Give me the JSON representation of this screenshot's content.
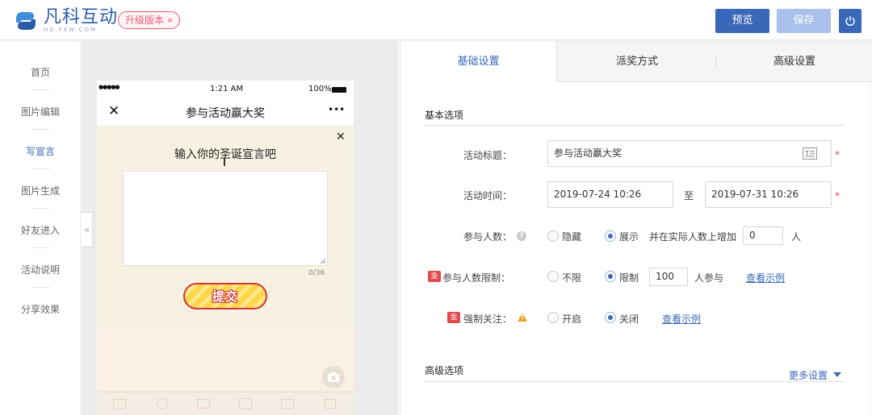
{
  "header": {
    "logo_name": "凡科互动",
    "logo_domain": "HD.FKW.COM",
    "upgrade_label": "升级版本 »",
    "preview_label": "预览",
    "save_label": "保存"
  },
  "nav": {
    "items": [
      {
        "label": "首页",
        "active": false
      },
      {
        "label": "图片编辑",
        "active": false
      },
      {
        "label": "写宣言",
        "active": true
      },
      {
        "label": "图片生成",
        "active": false
      },
      {
        "label": "好友进入",
        "active": false
      },
      {
        "label": "活动说明",
        "active": false
      },
      {
        "label": "分享效果",
        "active": false
      }
    ],
    "collapse_label": "«"
  },
  "phone": {
    "status_dots": "●●●●●",
    "status_time": "1:21 AM",
    "status_battery": "100%",
    "title": "参与活动赢大奖",
    "close_label": "✕",
    "more_label": "•••",
    "dialog_close": "✕",
    "prompt": "输入你的圣诞宣言吧",
    "counter": "0/36",
    "submit_label": "提交"
  },
  "tabs": [
    {
      "label": "基础设置",
      "active": true
    },
    {
      "label": "派奖方式",
      "active": false
    },
    {
      "label": "高级设置",
      "active": false
    }
  ],
  "basic": {
    "section_title": "基本选项",
    "title_label": "活动标题：",
    "title_value": "参与活动赢大奖",
    "time_label": "活动时间：",
    "time_start": "2019-07-24 10:26",
    "time_sep": "至",
    "time_end": "2019-07-31 10:26",
    "required_mark": "*",
    "count_label": "参与人数：",
    "count_help": "?",
    "count_hide": "隐藏",
    "count_show": "展示",
    "count_add_text": "并在实际人数上增加",
    "count_add_value": "0",
    "count_unit": "人",
    "limit_badge": "金",
    "limit_label": "参与人数限制：",
    "limit_none": "不限",
    "limit_yes": "限制",
    "limit_value": "100",
    "limit_unit": "人参与",
    "limit_example": "查看示例",
    "follow_badge": "金",
    "follow_label": "强制关注：",
    "follow_warn": "!",
    "follow_on": "开启",
    "follow_off": "关闭",
    "follow_example": "查看示例"
  },
  "advanced": {
    "section_title": "高级选项",
    "more_label": "更多设置"
  },
  "colors": {
    "accent": "#3a68b9",
    "save_disabled": "#a9c1ec",
    "upgrade": "#f05a78",
    "required": "#e84a4a"
  }
}
